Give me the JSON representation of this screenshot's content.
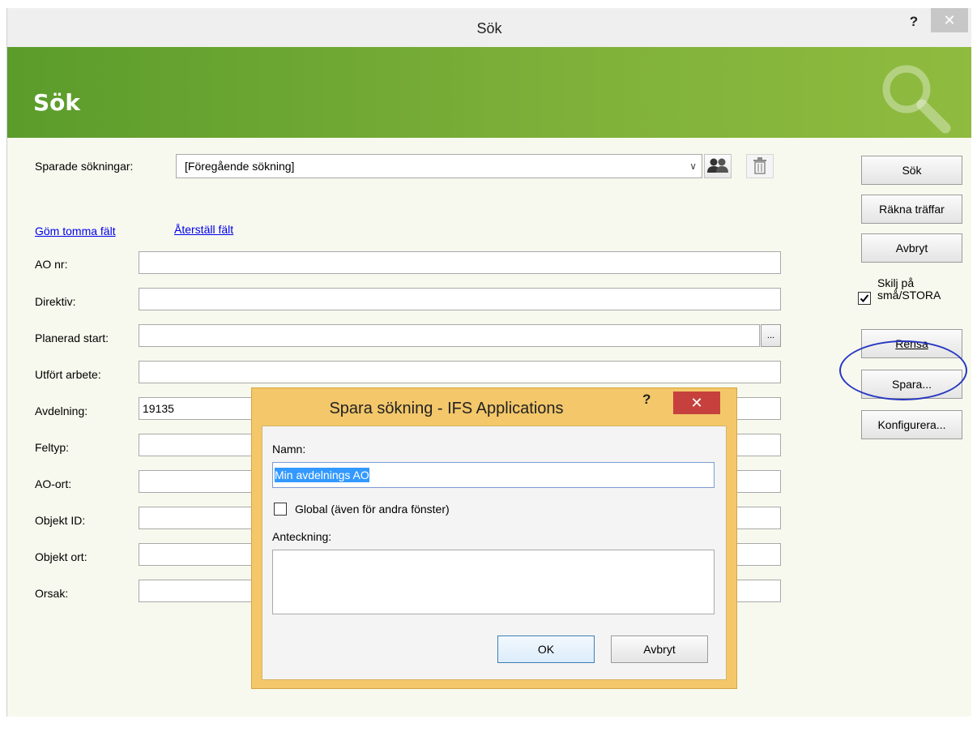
{
  "window": {
    "title": "Sök",
    "help": "?",
    "close": "✕"
  },
  "banner": {
    "title": "Sök"
  },
  "saved_search": {
    "label": "Sparade sökningar:",
    "value": "[Föregående sökning]"
  },
  "links": {
    "hide_empty": "Göm tomma fält",
    "reset_fields": "Återställ fält"
  },
  "fields": [
    {
      "label": "AO nr:",
      "value": ""
    },
    {
      "label": "Direktiv:",
      "value": ""
    },
    {
      "label": "Planerad start:",
      "value": ""
    },
    {
      "label": "Utfört arbete:",
      "value": ""
    },
    {
      "label": "Avdelning:",
      "value": "19135"
    },
    {
      "label": "Feltyp:",
      "value": ""
    },
    {
      "label": "AO-ort:",
      "value": ""
    },
    {
      "label": "Objekt ID:",
      "value": ""
    },
    {
      "label": "Objekt ort:",
      "value": ""
    },
    {
      "label": "Orsak:",
      "value": ""
    }
  ],
  "ellipsis_button": "...",
  "side": {
    "search": "Sök",
    "count_hits": "Räkna träffar",
    "cancel": "Avbryt",
    "case_sensitive_line1": "Skilj på",
    "case_sensitive_line2": "små/STORA",
    "case_sensitive_checked": true,
    "clear": "Rensa",
    "save": "Spara...",
    "configure": "Konfigurera..."
  },
  "dialog": {
    "title": "Spara sökning - IFS Applications",
    "help": "?",
    "close": "✕",
    "name_label": "Namn:",
    "name_value": "Min avdelnings AO",
    "global_label": "Global (även för andra fönster)",
    "global_checked": false,
    "note_label": "Anteckning:",
    "note_value": "",
    "ok": "OK",
    "cancel": "Avbryt"
  },
  "colors": {
    "banner": "#6fa834",
    "accent_dialog": "#f3c76a",
    "close_red": "#c6413d",
    "highlight": "#2636c2"
  }
}
